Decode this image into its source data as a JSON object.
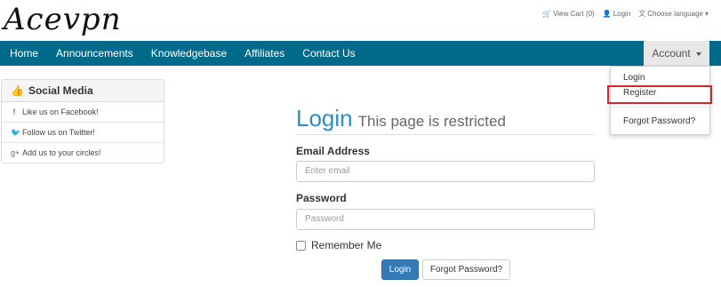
{
  "logo": {
    "text": "Acevpn"
  },
  "top_links": {
    "cart": "View Cart (0)",
    "login": "Login",
    "language": "Choose language"
  },
  "nav": {
    "items": [
      "Home",
      "Announcements",
      "Knowledgebase",
      "Affiliates",
      "Contact Us"
    ],
    "account": "Account"
  },
  "account_menu": {
    "login": "Login",
    "register": "Register",
    "forgot": "Forgot Password?"
  },
  "sidebar": {
    "title": "Social Media",
    "items": [
      {
        "icon": "f",
        "label": "Like us on Facebook!"
      },
      {
        "icon": "🐦",
        "label": "Follow us on Twitter!"
      },
      {
        "icon": "g+",
        "label": "Add us to your circles!"
      }
    ]
  },
  "login": {
    "title": "Login",
    "subtitle": "This page is restricted",
    "email_label": "Email Address",
    "email_placeholder": "Enter email",
    "password_label": "Password",
    "password_placeholder": "Password",
    "remember": "Remember Me",
    "submit": "Login",
    "forgot": "Forgot Password?"
  },
  "colors": {
    "nav_bg": "#006a8a",
    "title_blue": "#2a8fc7",
    "button_blue": "#337ab7",
    "highlight": "#d9262a"
  }
}
